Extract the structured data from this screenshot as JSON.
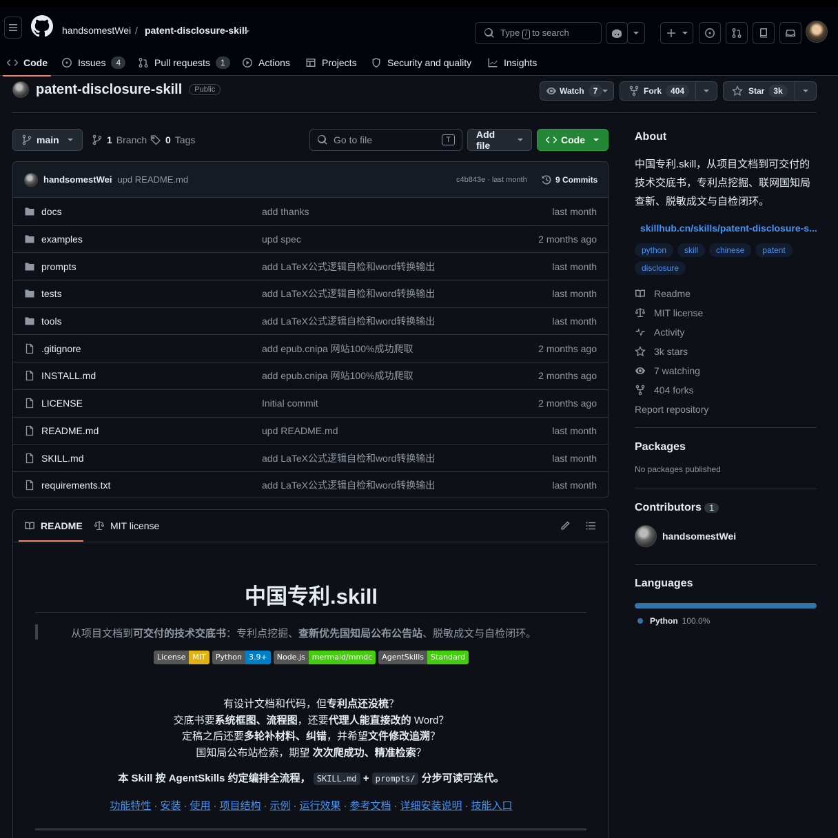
{
  "header": {
    "owner": "handsomestWei",
    "separator": "/",
    "repo": "patent-disclosure-skill",
    "search_prefix": "Type",
    "search_key": "/",
    "search_suffix": "to search"
  },
  "tabs": [
    {
      "label": "Code"
    },
    {
      "label": "Issues",
      "count": "4"
    },
    {
      "label": "Pull requests",
      "count": "1"
    },
    {
      "label": "Actions"
    },
    {
      "label": "Projects"
    },
    {
      "label": "Security and quality"
    },
    {
      "label": "Insights"
    }
  ],
  "repo": {
    "name": "patent-disclosure-skill",
    "visibility": "Public",
    "watch_label": "Watch",
    "watch_count": "7",
    "fork_label": "Fork",
    "fork_count": "404",
    "star_label": "Star",
    "star_count": "3k"
  },
  "toolbar": {
    "branch": "main",
    "branches_count": "1",
    "branches_label": "Branch",
    "tags_count": "0",
    "tags_label": "Tags",
    "goto_placeholder": "Go to file",
    "goto_key": "T",
    "add_file": "Add file",
    "code": "Code"
  },
  "last_commit": {
    "author": "handsomestWei",
    "message": "upd README.md",
    "hash_time": "c4b843e · last month",
    "commits": "9 Commits"
  },
  "files": [
    {
      "name": "docs",
      "type": "dir",
      "message": "add thanks",
      "date": "last month"
    },
    {
      "name": "examples",
      "type": "dir",
      "message": "upd spec",
      "date": "2 months ago"
    },
    {
      "name": "prompts",
      "type": "dir",
      "message": "add LaTeX公式逻辑自检和word转换输出",
      "date": "last month"
    },
    {
      "name": "tests",
      "type": "dir",
      "message": "add LaTeX公式逻辑自检和word转换输出",
      "date": "last month"
    },
    {
      "name": "tools",
      "type": "dir",
      "message": "add LaTeX公式逻辑自检和word转换输出",
      "date": "last month"
    },
    {
      "name": ".gitignore",
      "type": "file",
      "message": "add epub.cnipa 网站100%成功爬取",
      "date": "2 months ago"
    },
    {
      "name": "INSTALL.md",
      "type": "file",
      "message": "add epub.cnipa 网站100%成功爬取",
      "date": "2 months ago"
    },
    {
      "name": "LICENSE",
      "type": "file",
      "message": "Initial commit",
      "date": "2 months ago"
    },
    {
      "name": "README.md",
      "type": "file",
      "message": "upd README.md",
      "date": "last month"
    },
    {
      "name": "SKILL.md",
      "type": "file",
      "message": "add LaTeX公式逻辑自检和word转换输出",
      "date": "last month"
    },
    {
      "name": "requirements.txt",
      "type": "file",
      "message": "add LaTeX公式逻辑自检和word转换输出",
      "date": "last month"
    }
  ],
  "readme": {
    "tab_readme": "README",
    "tab_license": "MIT license",
    "title": "中国专利.skill",
    "quote_a": "从项目文档到",
    "quote_b": "可交付的技术交底书",
    "quote_c": "：专利点挖掘、",
    "quote_d": "查新优先国知局公布公告站",
    "quote_e": "、脱敏成文与自检闭环。",
    "badges": [
      {
        "left": "License",
        "right": "MIT",
        "color": "#dfb317"
      },
      {
        "left": "Python",
        "right": "3.9+",
        "color": "#007ec6"
      },
      {
        "left": "Node.js",
        "right": "mermaid/mmdc",
        "color": "#4c1"
      },
      {
        "left": "AgentSkills",
        "right": "Standard",
        "color": "#44cc11"
      }
    ],
    "line1a": "有设计文档和代码，但",
    "line1b": "专利点还没梳",
    "line1c": "？",
    "line2a": "交底书要",
    "line2b": "系统框图、流程图",
    "line2c": "，还要",
    "line2d": "代理人能直接改的",
    "line2e": " Word？",
    "line3a": "定稿之后还要",
    "line3b": "多轮补材料、纠错",
    "line3c": "，并希望",
    "line3d": "文件修改追溯",
    "line3e": "？",
    "line4a": "国知局公布站检索，期望 ",
    "line4b": "次次爬成功、精准检索",
    "line4c": "？",
    "line5a": "本 Skill 按 AgentSkills 约定编排全流程，",
    "line5_code1": "SKILL.md",
    "line5_plus": "+",
    "line5_code2": "prompts/",
    "line5b": "分步可读可迭代。",
    "links": [
      "功能特性",
      "安装",
      "使用",
      "项目结构",
      "示例",
      "运行效果",
      "参考文档",
      "详细安装说明",
      "技能入口"
    ],
    "link_sep": "·"
  },
  "about": {
    "heading": "About",
    "description": "中国专利.skill，从项目文档到可交付的技术交底书，专利点挖掘、联网国知局查新、脱敏成文与自检闭环。",
    "link": "skillhub.cn/skills/patent-disclosure-s...",
    "topics": [
      "python",
      "skill",
      "chinese",
      "patent",
      "disclosure"
    ],
    "readme": "Readme",
    "license": "MIT license",
    "activity": "Activity",
    "stars": "3k stars",
    "watching": "7 watching",
    "forks": "404 forks",
    "report": "Report repository"
  },
  "packages": {
    "heading": "Packages",
    "text": "No packages published"
  },
  "contributors": {
    "heading": "Contributors",
    "count": "1",
    "name": "handsomestWei"
  },
  "languages": {
    "heading": "Languages",
    "name": "Python",
    "percent": "100.0%",
    "fraction": 1.0,
    "color": "#3572A5"
  }
}
